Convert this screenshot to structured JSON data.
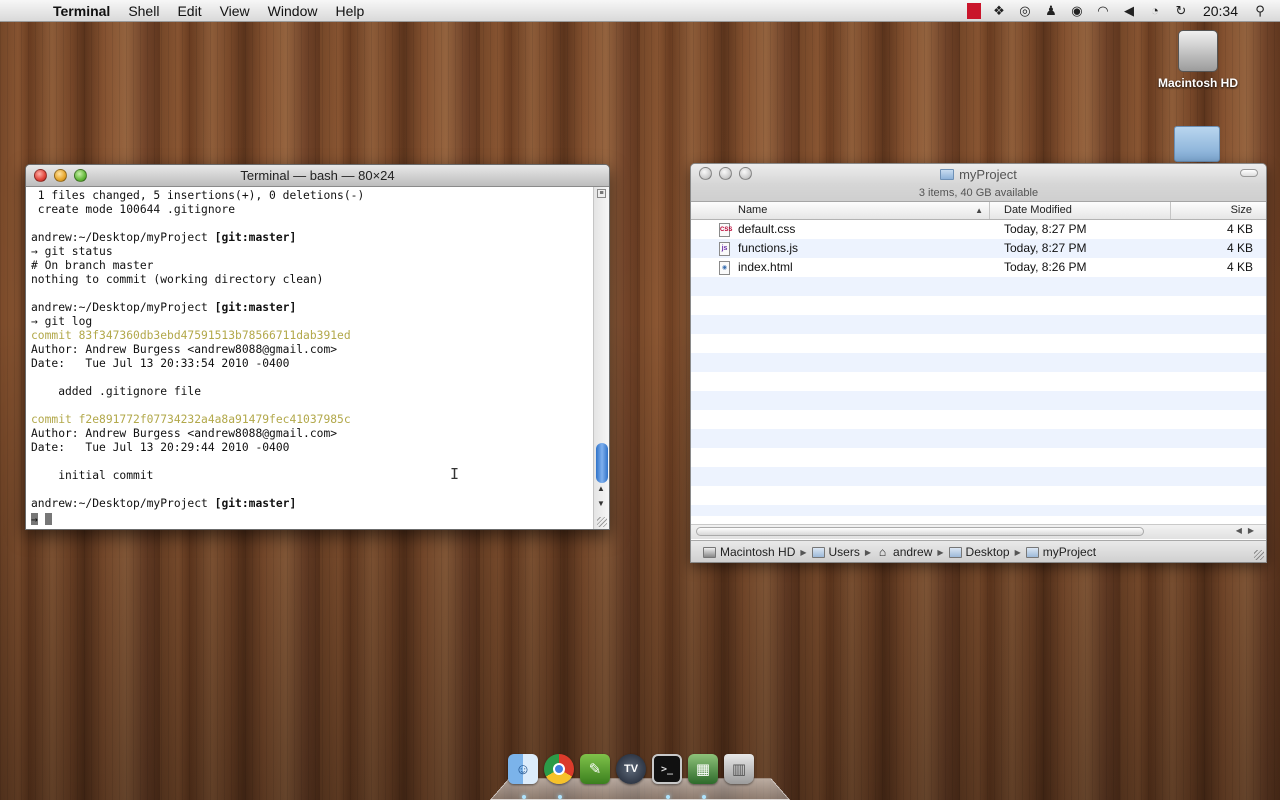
{
  "menubar": {
    "app_name": "Terminal",
    "items": [
      "Shell",
      "Edit",
      "View",
      "Window",
      "Help"
    ],
    "clock": "20:34"
  },
  "desktop": {
    "hd_label": "Macintosh HD"
  },
  "terminal": {
    "title": "Terminal — bash — 80×24",
    "lines": [
      {
        "type": "text",
        "text": " 1 files changed, 5 insertions(+), 0 deletions(-)"
      },
      {
        "type": "text",
        "text": " create mode 100644 .gitignore"
      },
      {
        "type": "text",
        "text": ""
      },
      {
        "type": "prompt",
        "text": "andrew:~/Desktop/myProject ",
        "branch": "[git:master]"
      },
      {
        "type": "text",
        "text": "→ git status"
      },
      {
        "type": "text",
        "text": "# On branch master"
      },
      {
        "type": "text",
        "text": "nothing to commit (working directory clean)"
      },
      {
        "type": "text",
        "text": ""
      },
      {
        "type": "prompt",
        "text": "andrew:~/Desktop/myProject ",
        "branch": "[git:master]"
      },
      {
        "type": "text",
        "text": "→ git log"
      },
      {
        "type": "commit",
        "text": "commit 83f347360db3ebd47591513b78566711dab391ed"
      },
      {
        "type": "text",
        "text": "Author: Andrew Burgess <andrew8088@gmail.com>"
      },
      {
        "type": "text",
        "text": "Date:   Tue Jul 13 20:33:54 2010 -0400"
      },
      {
        "type": "text",
        "text": ""
      },
      {
        "type": "text",
        "text": "    added .gitignore file"
      },
      {
        "type": "text",
        "text": ""
      },
      {
        "type": "commit",
        "text": "commit f2e891772f07734232a4a8a91479fec41037985c"
      },
      {
        "type": "text",
        "text": "Author: Andrew Burgess <andrew8088@gmail.com>"
      },
      {
        "type": "text",
        "text": "Date:   Tue Jul 13 20:29:44 2010 -0400"
      },
      {
        "type": "text",
        "text": ""
      },
      {
        "type": "text",
        "text": "    initial commit"
      },
      {
        "type": "text",
        "text": ""
      },
      {
        "type": "prompt",
        "text": "andrew:~/Desktop/myProject ",
        "branch": "[git:master]"
      },
      {
        "type": "cursor",
        "text": "→ "
      }
    ]
  },
  "finder": {
    "title": "myProject",
    "status": "3 items, 40 GB available",
    "columns": {
      "name": "Name",
      "date": "Date Modified",
      "size": "Size"
    },
    "files": [
      {
        "name": "default.css",
        "date": "Today, 8:27 PM",
        "size": "4 KB",
        "icon": "css",
        "icon_label": "CSS"
      },
      {
        "name": "functions.js",
        "date": "Today, 8:27 PM",
        "size": "4 KB",
        "icon": "js",
        "icon_label": "js"
      },
      {
        "name": "index.html",
        "date": "Today, 8:26 PM",
        "size": "4 KB",
        "icon": "html",
        "icon_label": "◉"
      }
    ],
    "path": [
      "Macintosh HD",
      "Users",
      "andrew",
      "Desktop",
      "myProject"
    ]
  },
  "dock": {
    "apps": [
      "finder-icon",
      "chrome-icon",
      "coda-icon",
      "tv-icon",
      "terminal-icon",
      "activity-icon",
      "trash-icon"
    ]
  }
}
